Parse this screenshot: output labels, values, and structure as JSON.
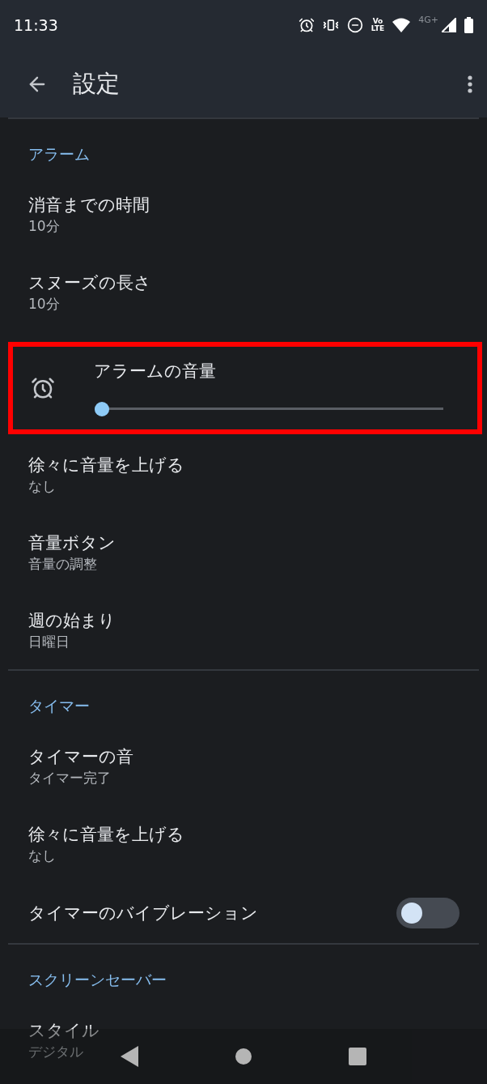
{
  "status_bar": {
    "time": "11:33",
    "volte": [
      "Vo",
      "LTE"
    ],
    "network": "4G+"
  },
  "app_bar": {
    "title": "設定"
  },
  "sections": [
    {
      "header": "アラーム",
      "items": [
        {
          "kind": "text",
          "title": "消音までの時間",
          "subtitle": "10分"
        },
        {
          "kind": "text",
          "title": "スヌーズの長さ",
          "subtitle": "10分"
        },
        {
          "kind": "slider",
          "title": "アラームの音量",
          "level": 0,
          "highlighted": true
        },
        {
          "kind": "text",
          "title": "徐々に音量を上げる",
          "subtitle": "なし"
        },
        {
          "kind": "text",
          "title": "音量ボタン",
          "subtitle": "音量の調整"
        },
        {
          "kind": "text",
          "title": "週の始まり",
          "subtitle": "日曜日"
        }
      ]
    },
    {
      "header": "タイマー",
      "items": [
        {
          "kind": "text",
          "title": "タイマーの音",
          "subtitle": "タイマー完了"
        },
        {
          "kind": "text",
          "title": "徐々に音量を上げる",
          "subtitle": "なし"
        },
        {
          "kind": "toggle",
          "title": "タイマーのバイブレーション",
          "on": false
        }
      ]
    },
    {
      "header": "スクリーンセーバー",
      "items": [
        {
          "kind": "text",
          "title": "スタイル",
          "subtitle": "デジタル"
        }
      ]
    }
  ]
}
